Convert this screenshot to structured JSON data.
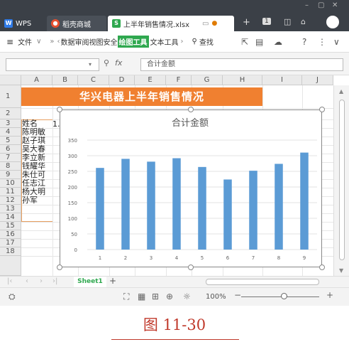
{
  "window": {
    "wps_tab": "WPS",
    "store_tab": "稻壳商城",
    "file_tab": "上半年销售情况.xlsx",
    "unsaved_dot": "●",
    "add_tab": "+",
    "tab_count": "1"
  },
  "menu": {
    "hamburger": "≡",
    "file": "文件",
    "chevron": "»",
    "items": [
      "数据",
      "审阅",
      "视图",
      "安全"
    ],
    "drawing_tools": "绘图工具",
    "text_tools": "文本工具",
    "search": "查找",
    "help": "?"
  },
  "formula_bar": {
    "fx": "fx",
    "content": "合计金额"
  },
  "columns": [
    "A",
    "B",
    "C",
    "D",
    "E",
    "F",
    "G",
    "H",
    "I",
    "J"
  ],
  "rows": [
    "1",
    "2",
    "3",
    "4",
    "5",
    "6",
    "7",
    "8",
    "9",
    "10",
    "11",
    "12",
    "13",
    "14",
    "15",
    "16",
    "17",
    "18"
  ],
  "sheet": {
    "title": "华兴电器上半年销售情况",
    "header_a": "姓名",
    "header_b": "1.",
    "names": [
      "陈明敏",
      "赵子琪",
      "吴大春",
      "李立新",
      "钱耀华",
      "朱仕可",
      "任志江",
      "杨大明",
      "孙军"
    ]
  },
  "chart_data": {
    "type": "bar",
    "title": "合计金额",
    "categories": [
      "1",
      "2",
      "3",
      "4",
      "5",
      "6",
      "7",
      "8",
      "9"
    ],
    "values": [
      261,
      290,
      281,
      292,
      264,
      224,
      252,
      274,
      310
    ],
    "yticks": [
      "0",
      "50",
      "100",
      "150",
      "200",
      "250",
      "300",
      "350"
    ],
    "ylim": [
      0,
      350
    ],
    "grid": true,
    "bar_color": "#5b9bd5"
  },
  "sheet_tabs": {
    "active": "Sheet1",
    "add": "+"
  },
  "status": {
    "zoom": "100%",
    "minus": "−",
    "plus": "+"
  },
  "caption": "图 11-30",
  "colors": {
    "title_fill": "#f08030",
    "accent_green": "#2fa84f",
    "caption_red": "#c0392b"
  }
}
